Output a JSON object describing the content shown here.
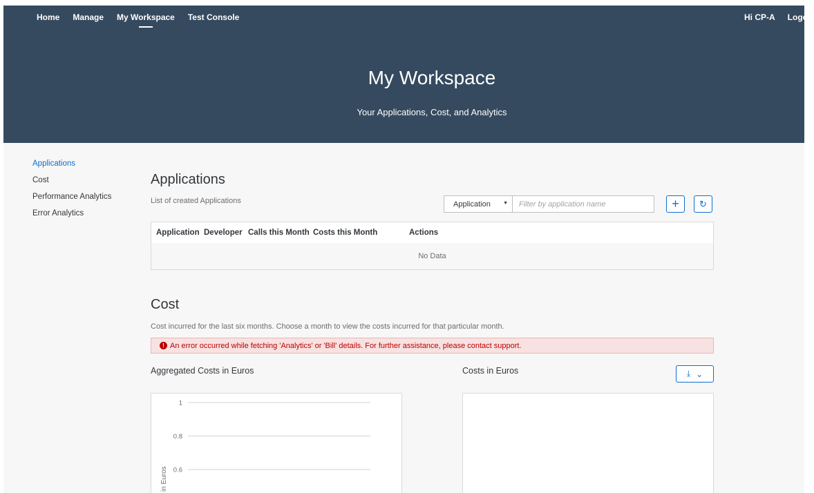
{
  "nav": {
    "items": [
      "Home",
      "Manage",
      "My Workspace",
      "Test Console"
    ],
    "active": "My Workspace",
    "greeting": "Hi CP-A",
    "logout": "Logou"
  },
  "hero": {
    "title": "My Workspace",
    "subtitle": "Your Applications, Cost, and Analytics"
  },
  "sidebar": {
    "items": [
      {
        "label": "Applications",
        "active": true
      },
      {
        "label": "Cost",
        "active": false
      },
      {
        "label": "Performance Analytics",
        "active": false
      },
      {
        "label": "Error Analytics",
        "active": false
      }
    ]
  },
  "applications": {
    "title": "Applications",
    "description": "List of created Applications",
    "filter": {
      "select_value": "Application",
      "placeholder": "Filter by application name"
    },
    "add_icon": "plus-icon",
    "refresh_icon": "refresh-icon",
    "columns": [
      "Application",
      "Developer",
      "Calls this Month",
      "Costs this Month",
      "Actions"
    ],
    "empty_text": "No Data"
  },
  "cost": {
    "title": "Cost",
    "description": "Cost incurred for the last six months. Choose a month to view the costs incurred for that particular month.",
    "error": "An error occurred while fetching 'Analytics' or 'Bill' details. For further assistance, please contact support.",
    "aggregated_title": "Aggregated Costs in Euros",
    "costs_title": "Costs in Euros",
    "download_icon": "download-icon"
  },
  "chart_data": {
    "type": "line",
    "title": "Aggregated Costs in Euros",
    "ylabel": "in Euros",
    "yticks": [
      "1",
      "0.8",
      "0.6"
    ],
    "ylim": [
      0,
      1
    ],
    "grid": true,
    "series": []
  },
  "colors": {
    "header_bg": "#354a5f",
    "accent": "#0a6ed1",
    "error": "#bb0000"
  }
}
